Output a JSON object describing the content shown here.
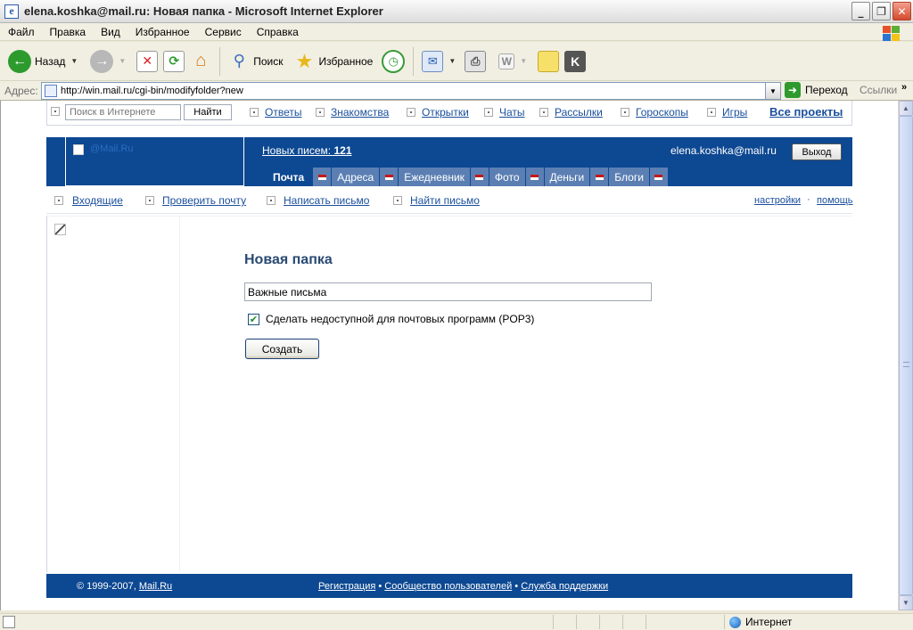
{
  "window": {
    "title": "elena.koshka@mail.ru: Новая папка - Microsoft Internet Explorer",
    "buttons": [
      "_",
      "❐",
      "✕"
    ]
  },
  "menu": [
    "Файл",
    "Правка",
    "Вид",
    "Избранное",
    "Сервис",
    "Справка"
  ],
  "toolbar": {
    "back_label": "Назад",
    "search_label": "Поиск",
    "favorites_label": "Избранное"
  },
  "address": {
    "label": "Адрес:",
    "url": "http://win.mail.ru/cgi-bin/modifyfolder?new",
    "go_label": "Переход",
    "links_label": "Ссылки"
  },
  "topnav": {
    "search_placeholder": "Поиск в Интернете",
    "search_button": "Найти",
    "links": [
      "Ответы",
      "Знакомства",
      "Открытки",
      "Чаты",
      "Рассылки",
      "Гороскопы",
      "Игры"
    ],
    "all_projects": "Все проекты"
  },
  "header": {
    "logo_text": "@Mail.Ru",
    "new_mail_label": "Новых писем:",
    "new_mail_count": "121",
    "user_email": "elena.koshka@mail.ru",
    "logout": "Выход",
    "tabs": [
      "Почта",
      "Адреса",
      "Ежедневник",
      "Фото",
      "Деньги",
      "Блоги"
    ]
  },
  "subnav": {
    "links": [
      "Входящие",
      "Проверить почту",
      "Написать письмо",
      "Найти письмо"
    ],
    "settings": "настройки",
    "separator": "·",
    "help": "помощь"
  },
  "form": {
    "title": "Новая папка",
    "folder_name": "Важные письма",
    "checkbox_label": "Сделать недоступной для почтовых программ (POP3)",
    "checkbox_checked": true,
    "submit": "Создать"
  },
  "footer": {
    "copyright": "© 1999-2007,",
    "site": "Mail.Ru",
    "link1": "Регистрация",
    "sep": "•",
    "link2": "Сообщество пользователей",
    "link3": "Служба поддержки"
  },
  "status": {
    "zone": "Интернет"
  }
}
